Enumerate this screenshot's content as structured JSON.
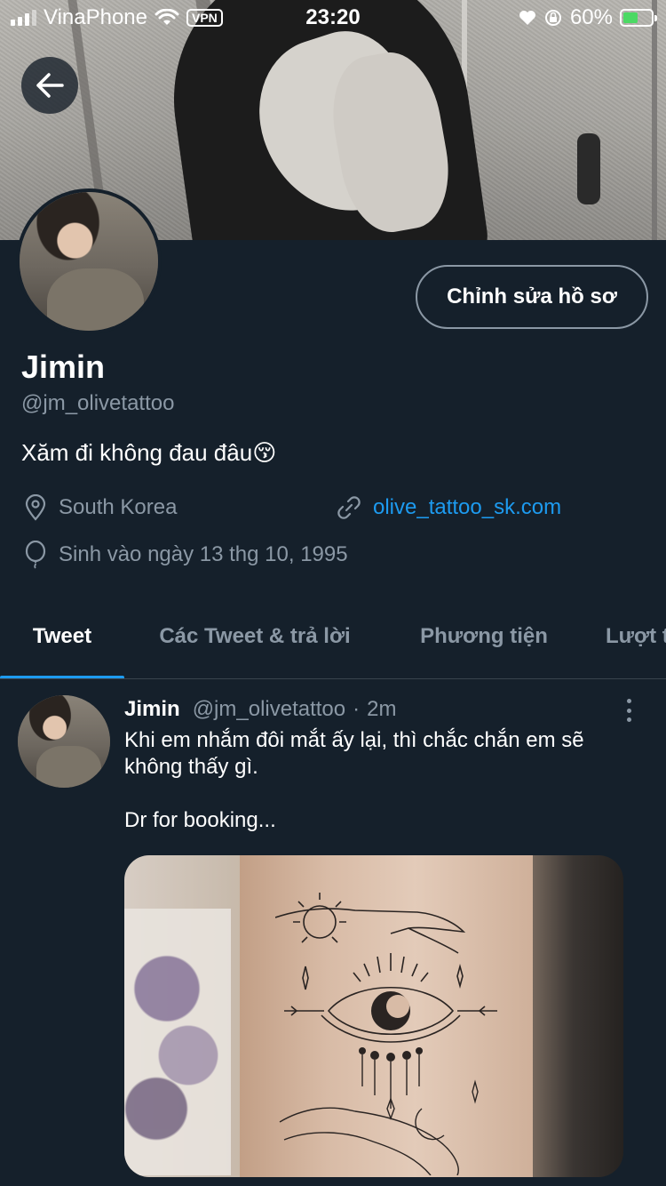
{
  "status_bar": {
    "carrier": "VinaPhone",
    "vpn": "VPN",
    "time": "23:20",
    "battery": "60%",
    "battery_level": 0.6
  },
  "profile": {
    "display_name": "Jimin",
    "handle": "@jm_olivetattoo",
    "bio": "Xăm đi không đau đâu😚",
    "location": "South Korea",
    "website": "olive_tattoo_sk.com",
    "birthday": "Sinh vào ngày 13 thg 10, 1995",
    "edit_button": "Chỉnh sửa hồ sơ"
  },
  "tabs": [
    {
      "label": "Tweet",
      "active": true
    },
    {
      "label": "Các Tweet & trả lời",
      "active": false
    },
    {
      "label": "Phương tiện",
      "active": false
    },
    {
      "label": "Lượt thích",
      "active": false
    }
  ],
  "tweet": {
    "name": "Jimin",
    "handle": "@jm_olivetattoo",
    "separator": "·",
    "time": "2m",
    "text": "Khi em nhắm đôi mắt ấy lại, thì chắc chắn em sẽ không thấy gì.\n\nDr for booking..."
  },
  "colors": {
    "background": "#15202b",
    "accent": "#1d9bf0",
    "secondary_text": "#8b98a5",
    "border": "#38444d"
  },
  "icons": {
    "back": "arrow-left-icon",
    "location": "location-pin-icon",
    "link": "link-icon",
    "birthday": "balloon-icon",
    "more": "more-vertical-icon"
  }
}
